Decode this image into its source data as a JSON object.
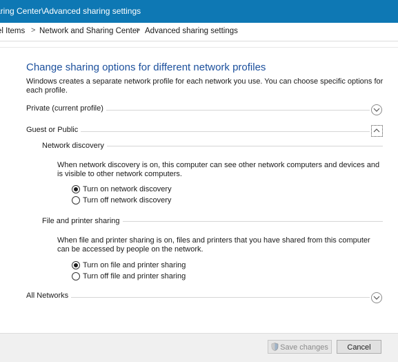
{
  "window": {
    "title": "aring Center\\Advanced sharing settings"
  },
  "breadcrumb": {
    "items": [
      "el Items",
      "Network and Sharing Center",
      "Advanced sharing settings"
    ],
    "separator": ">"
  },
  "main": {
    "heading": "Change sharing options for different network profiles",
    "intro": "Windows creates a separate network profile for each network you use. You can choose specific options for each profile.",
    "profiles": {
      "private": {
        "label": "Private (current profile)",
        "expanded": false
      },
      "guest": {
        "label": "Guest or Public",
        "expanded": true
      },
      "all": {
        "label": "All Networks",
        "expanded": false
      }
    },
    "network_discovery": {
      "label": "Network discovery",
      "description": "When network discovery is on, this computer can see other network computers and devices and is visible to other network computers.",
      "options": [
        "Turn on network discovery",
        "Turn off network discovery"
      ],
      "selected": 0
    },
    "file_printer": {
      "label": "File and printer sharing",
      "description": "When file and printer sharing is on, files and printers that you have shared from this computer can be accessed by people on the network.",
      "options": [
        "Turn on file and printer sharing",
        "Turn off file and printer sharing"
      ],
      "selected": 0
    }
  },
  "footer": {
    "save_label": "Save changes",
    "save_enabled": false,
    "cancel_label": "Cancel"
  },
  "colors": {
    "titlebar": "#0e78b4",
    "heading": "#1b4f9c"
  },
  "icons": {
    "expand": "chevron-down-icon",
    "collapse": "chevron-up-icon",
    "uac": "uac-shield-icon"
  }
}
